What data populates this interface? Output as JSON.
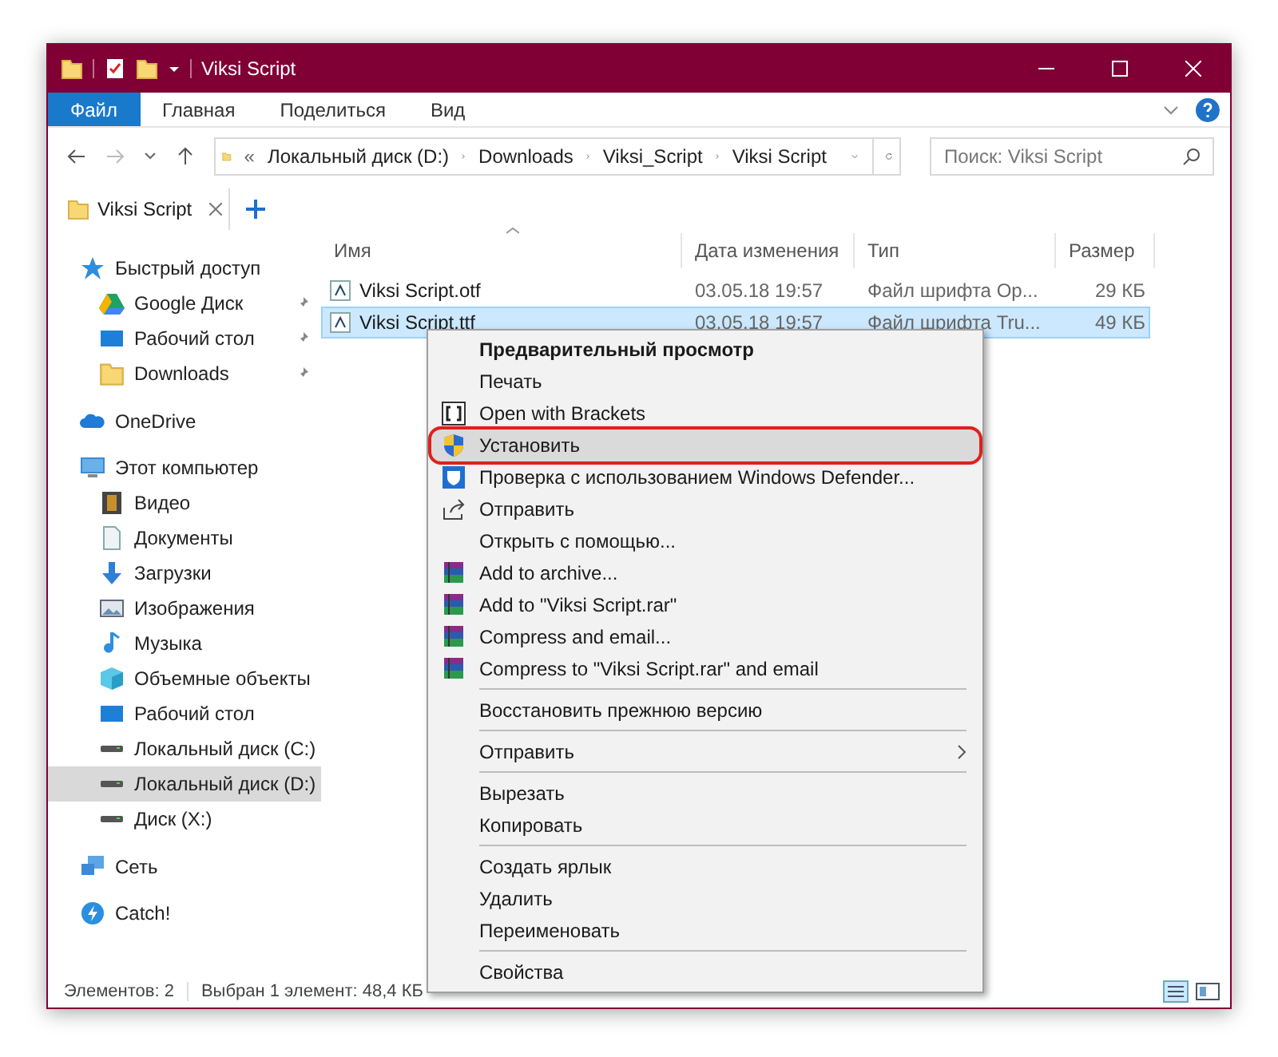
{
  "window": {
    "title": "Viksi Script"
  },
  "ribbon_tabs": [
    {
      "label": "Файл",
      "selected": true
    },
    {
      "label": "Главная",
      "selected": false
    },
    {
      "label": "Поделиться",
      "selected": false
    },
    {
      "label": "Вид",
      "selected": false
    }
  ],
  "address": {
    "overflow": "«",
    "crumbs": [
      "Локальный диск (D:)",
      "Downloads",
      "Viksi_Script",
      "Viksi Script"
    ]
  },
  "search": {
    "placeholder": "Поиск: Viksi Script"
  },
  "folder_tabs": [
    {
      "label": "Viksi Script",
      "selected": true
    }
  ],
  "sidebar": {
    "items": [
      {
        "label": "Быстрый доступ",
        "kind": "star",
        "selected": false,
        "children": [
          {
            "label": "Google Диск",
            "kind": "drive",
            "pinned": true,
            "selected": false
          },
          {
            "label": "Рабочий стол",
            "kind": "desktop",
            "pinned": true,
            "selected": false
          },
          {
            "label": "Downloads",
            "kind": "folder",
            "pinned": true,
            "selected": false
          }
        ]
      },
      {
        "label": "OneDrive",
        "kind": "cloud",
        "selected": false
      },
      {
        "label": "Этот компьютер",
        "kind": "computer",
        "selected": false,
        "children": [
          {
            "label": "Видео",
            "kind": "video",
            "selected": false
          },
          {
            "label": "Документы",
            "kind": "document",
            "selected": false
          },
          {
            "label": "Загрузки",
            "kind": "download",
            "selected": false
          },
          {
            "label": "Изображения",
            "kind": "image",
            "selected": false
          },
          {
            "label": "Музыка",
            "kind": "music",
            "selected": false
          },
          {
            "label": "Объемные объекты",
            "kind": "cube",
            "selected": false
          },
          {
            "label": "Рабочий стол",
            "kind": "desktop",
            "selected": false
          },
          {
            "label": "Локальный диск (C:)",
            "kind": "disk",
            "selected": false
          },
          {
            "label": "Локальный диск (D:)",
            "kind": "disk",
            "selected": true
          },
          {
            "label": "Диск (X:)",
            "kind": "disk",
            "selected": false
          }
        ]
      },
      {
        "label": "Сеть",
        "kind": "network",
        "selected": false
      },
      {
        "label": "Catch!",
        "kind": "catch",
        "selected": false
      }
    ]
  },
  "table": {
    "columns": [
      "Имя",
      "Дата изменения",
      "Тип",
      "Размер"
    ],
    "rows": [
      {
        "name": "Viksi Script.otf",
        "date": "03.05.18 19:57",
        "type": "Файл шрифта Op...",
        "size": "29 КБ",
        "selected": false
      },
      {
        "name": "Viksi Script.ttf",
        "date": "03.05.18 19:57",
        "type": "Файл шрифта Tru...",
        "size": "49 КБ",
        "selected": true
      }
    ]
  },
  "context_menu": {
    "groups": [
      [
        {
          "label": "Предварительный просмотр",
          "kind": "none",
          "bold": true,
          "selected": false
        },
        {
          "label": "Печать",
          "kind": "none",
          "bold": false,
          "selected": false
        },
        {
          "label": "Open with Brackets",
          "kind": "brackets",
          "bold": false,
          "selected": false
        },
        {
          "label": "Установить",
          "kind": "shield",
          "bold": false,
          "selected": true
        },
        {
          "label": "Проверка с использованием Windows Defender...",
          "kind": "defender",
          "bold": false,
          "selected": false
        },
        {
          "label": "Отправить",
          "kind": "share",
          "bold": false,
          "selected": false
        },
        {
          "label": "Открыть с помощью...",
          "kind": "none",
          "bold": false,
          "selected": false
        },
        {
          "label": "Add to archive...",
          "kind": "archive",
          "bold": false,
          "selected": false
        },
        {
          "label": "Add to \"Viksi Script.rar\"",
          "kind": "archive",
          "bold": false,
          "selected": false
        },
        {
          "label": "Compress and email...",
          "kind": "archive",
          "bold": false,
          "selected": false
        },
        {
          "label": "Compress to \"Viksi Script.rar\" and email",
          "kind": "archive",
          "bold": false,
          "selected": false
        }
      ],
      [
        {
          "label": "Восстановить прежнюю версию",
          "kind": "none",
          "bold": false,
          "selected": false
        }
      ],
      [
        {
          "label": "Отправить",
          "kind": "submenu",
          "bold": false,
          "selected": false
        }
      ],
      [
        {
          "label": "Вырезать",
          "kind": "none",
          "bold": false,
          "selected": false
        },
        {
          "label": "Копировать",
          "kind": "none",
          "bold": false,
          "selected": false
        }
      ],
      [
        {
          "label": "Создать ярлык",
          "kind": "none",
          "bold": false,
          "selected": false
        },
        {
          "label": "Удалить",
          "kind": "none",
          "bold": false,
          "selected": false
        },
        {
          "label": "Переименовать",
          "kind": "none",
          "bold": false,
          "selected": false
        }
      ],
      [
        {
          "label": "Свойства",
          "kind": "none",
          "bold": false,
          "selected": false
        }
      ]
    ]
  },
  "status_bar": {
    "count": "Элементов: 2",
    "selection": "Выбран 1 элемент: 48,4 КБ"
  }
}
